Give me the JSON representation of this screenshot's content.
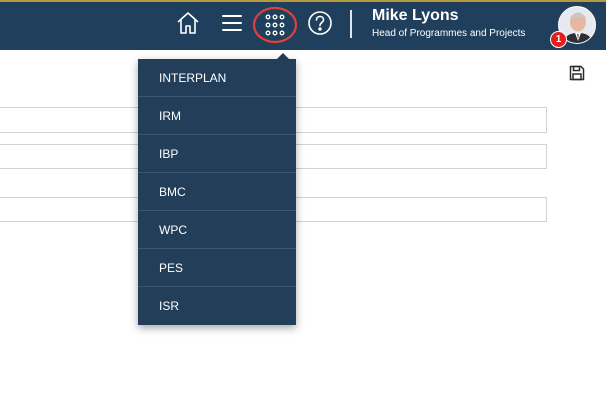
{
  "header": {
    "user_name": "Mike Lyons",
    "user_role": "Head of Programmes and Projects",
    "notification_count": "1",
    "background_color": "#1f3f5c",
    "accent_color": "#b59a3c",
    "icons": [
      "home-icon",
      "hamburger-menu-icon",
      "apps-grid-icon",
      "help-icon"
    ]
  },
  "apps_menu": {
    "items": [
      {
        "label": "INTERPLAN"
      },
      {
        "label": "IRM"
      },
      {
        "label": "IBP"
      },
      {
        "label": "BMC"
      },
      {
        "label": "WPC"
      },
      {
        "label": "PES"
      },
      {
        "label": "ISR"
      }
    ]
  }
}
